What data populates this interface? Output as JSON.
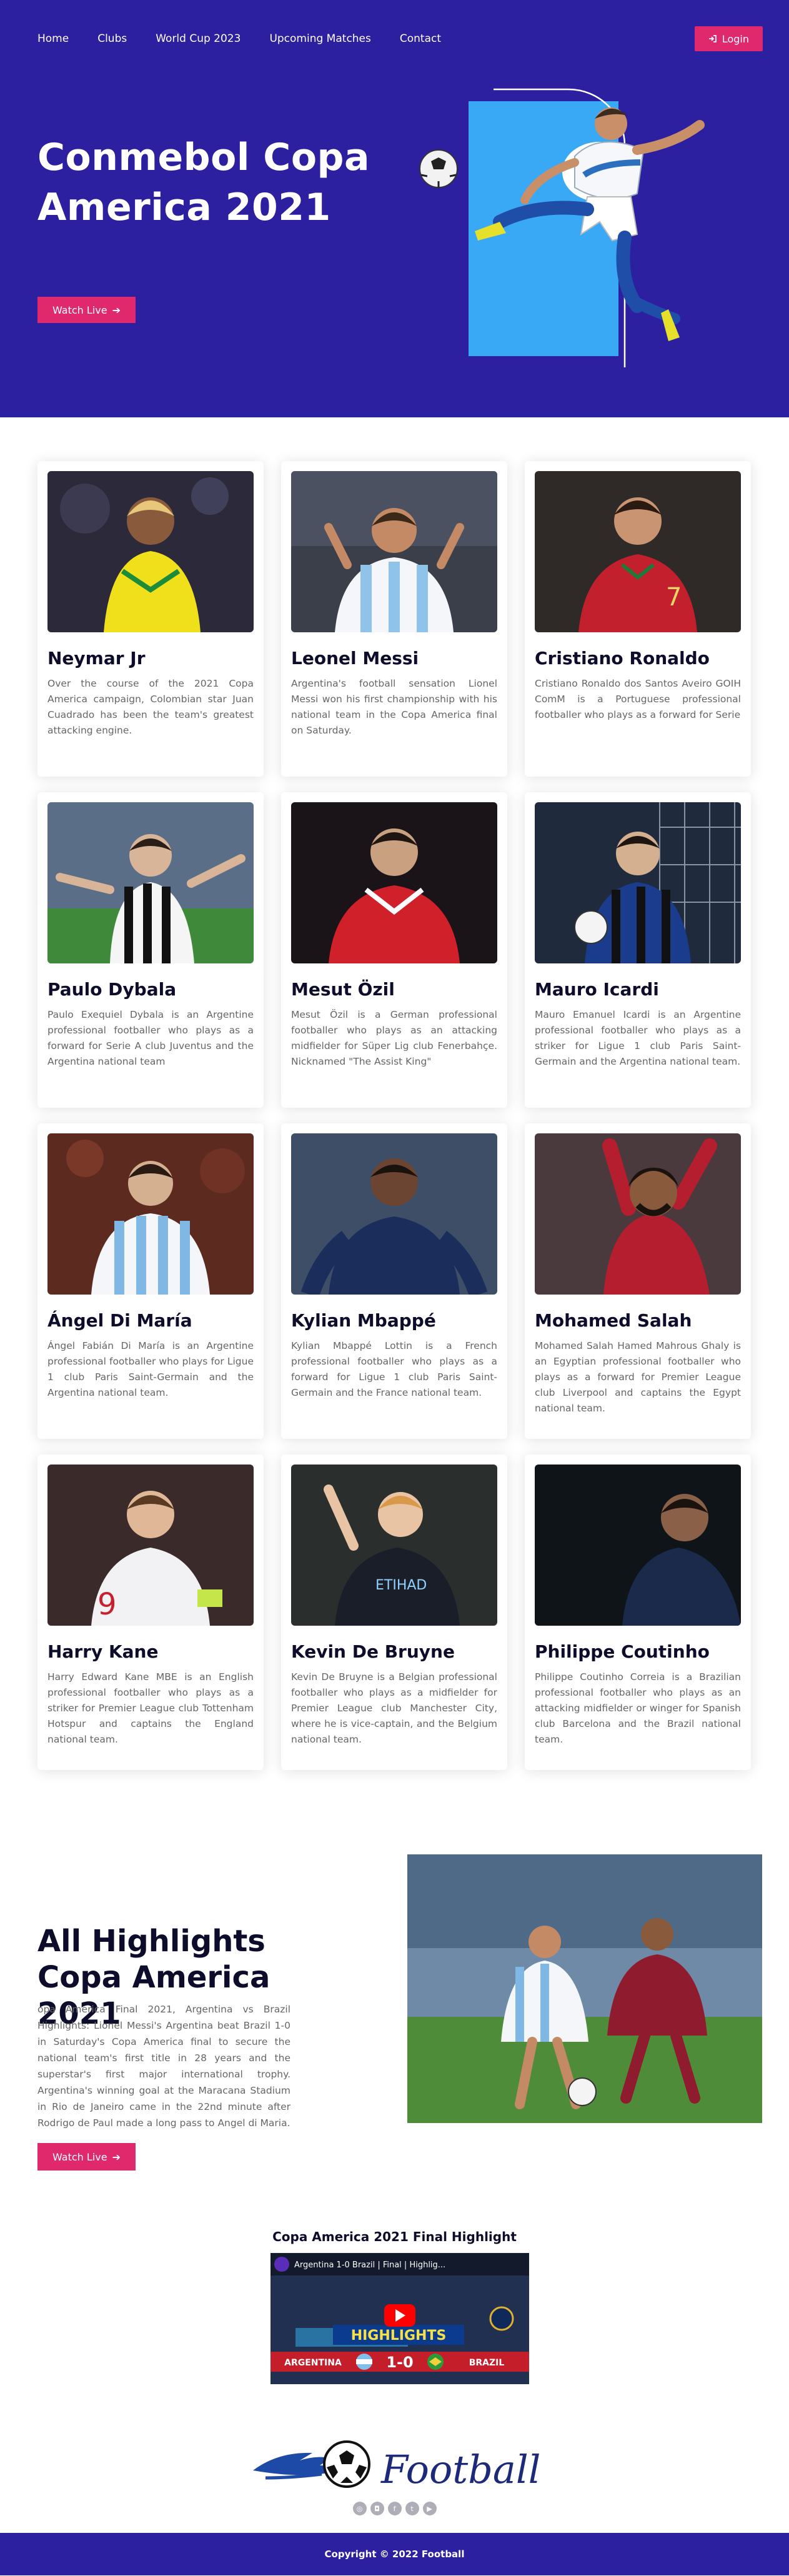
{
  "nav": {
    "links": [
      "Home",
      "Clubs",
      "World Cup 2023",
      "Upcoming Matches",
      "Contact"
    ],
    "login_label": "Login",
    "login_icon": "sign-in-icon"
  },
  "hero": {
    "title": "Conmebol Copa America 2021",
    "button_label": "Watch Live",
    "button_icon": "arrow-right-icon",
    "bg_color": "#2c1fa0",
    "accent_color": "#e0296d",
    "panel_color": "#3aa9f5"
  },
  "players": [
    {
      "name": "Neymar Jr",
      "desc": "Over the course of the 2021 Copa America campaign, Colombian star Juan Cuadrado has been the team's greatest attacking engine."
    },
    {
      "name": "Leonel Messi",
      "desc": "Argentina's football sensation Lionel Messi won his first championship with his national team in the Copa America final on Saturday."
    },
    {
      "name": "Cristiano Ronaldo",
      "desc": "Cristiano Ronaldo dos Santos Aveiro GOIH ComM is a Portuguese professional footballer who plays as a forward for Serie"
    },
    {
      "name": "Paulo Dybala",
      "desc": "Paulo Exequiel Dybala is an Argentine professional footballer who plays as a forward for Serie A club Juventus and the Argentina national team"
    },
    {
      "name": "Mesut Özil",
      "desc": "Mesut Özil is a German professional footballer who plays as an attacking midfielder for Süper Lig club Fenerbahçe. Nicknamed \"The Assist King\""
    },
    {
      "name": "Mauro Icardi",
      "desc": "Mauro Emanuel Icardi is an Argentine professional footballer who plays as a striker for Ligue 1 club Paris Saint-Germain and the Argentina national team."
    },
    {
      "name": "Ángel Di María",
      "desc": "Ángel Fabián Di María is an Argentine professional footballer who plays for Ligue 1 club Paris Saint-Germain and the Argentina national team."
    },
    {
      "name": "Kylian Mbappé",
      "desc": "Kylian Mbappé Lottin is a French professional footballer who plays as a forward for Ligue 1 club Paris Saint-Germain and the France national team."
    },
    {
      "name": "Mohamed Salah",
      "desc": "Mohamed Salah Hamed Mahrous Ghaly is an Egyptian professional footballer who plays as a forward for Premier League club Liverpool and captains the Egypt national team."
    },
    {
      "name": "Harry Kane",
      "desc": "Harry Edward Kane MBE is an English professional footballer who plays as a striker for Premier League club Tottenham Hotspur and captains the England national team."
    },
    {
      "name": "Kevin De Bruyne",
      "desc": "Kevin De Bruyne is a Belgian professional footballer who plays as a midfielder for Premier League club Manchester City, where he is vice-captain, and the Belgium national team."
    },
    {
      "name": "Philippe Coutinho",
      "desc": "Philippe Coutinho Correia is a Brazilian professional footballer who plays as an attacking midfielder or winger for Spanish club Barcelona and the Brazil national team."
    }
  ],
  "highlights": {
    "title": "All Highlights Copa America 2021",
    "desc": "opa America Final 2021, Argentina vs Brazil Highlights: Lionel Messi's Argentina beat Brazil 1-0 in Saturday's Copa America final to secure the national team's first title in 28 years and the superstar's first major international trophy. Argentina's winning goal at the Maracana Stadium in Rio de Janeiro came in the 22nd minute after Rodrigo de Paul made a long pass to Angel di Maria.",
    "button_label": "Watch Live"
  },
  "video": {
    "section_title": "Copa America 2021 Final Highlight",
    "video_title": "Argentina 1-0 Brazil | Final | Highlig...",
    "banner": "HIGHLIGHTS",
    "team_left": "ARGENTINA",
    "score": "1-0",
    "team_right": "BRAZIL"
  },
  "footer": {
    "brand": "Football",
    "socials": [
      "globe-icon",
      "instagram-icon",
      "facebook-icon",
      "twitter-icon",
      "youtube-icon"
    ],
    "copyright": "Copyright © 2022 Football"
  }
}
